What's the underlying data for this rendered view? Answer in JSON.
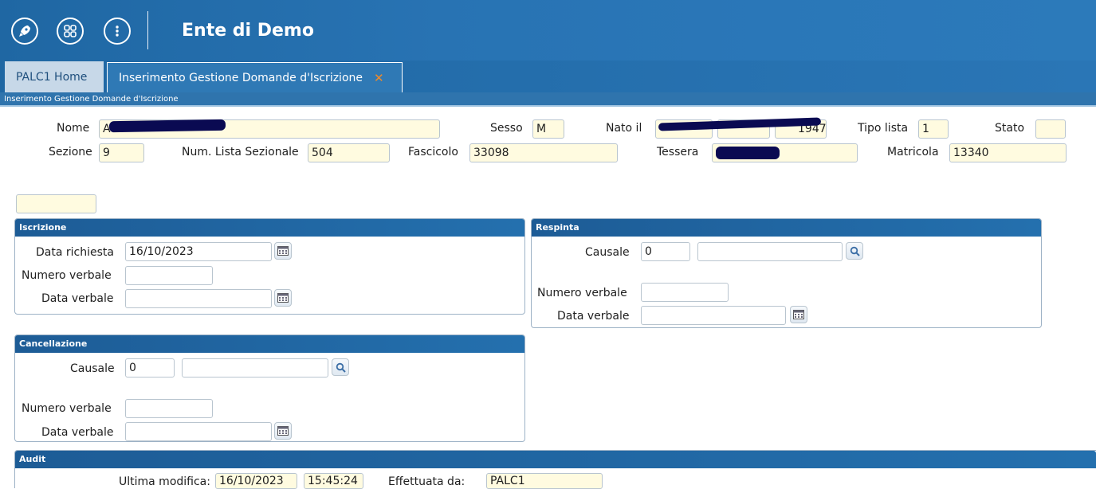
{
  "header": {
    "title": "Ente di Demo",
    "icons": [
      "rocket-icon",
      "apps-grid-icon",
      "more-vertical-icon"
    ]
  },
  "tabs": [
    {
      "label": "PALC1 Home",
      "active": false
    },
    {
      "label": "Inserimento Gestione Domande d'Iscrizione",
      "active": true,
      "close": "✕"
    }
  ],
  "breadcrumb": "Inserimento Gestione Domande d'Iscrizione",
  "anagrafica": {
    "nome_label": "Nome",
    "nome_value": "A",
    "sesso_label": "Sesso",
    "sesso_value": "M",
    "nato_label": "Nato il",
    "nato_year_value": "1947",
    "tipo_lista_label": "Tipo lista",
    "tipo_lista_value": "1",
    "stato_label": "Stato",
    "stato_value": "",
    "sezione_label": "Sezione",
    "sezione_value": "9",
    "num_lista_label": "Num. Lista Sezionale",
    "num_lista_value": "504",
    "fascicolo_label": "Fascicolo",
    "fascicolo_value": "33098",
    "tessera_label": "Tessera",
    "tessera_value": "",
    "matricola_label": "Matricola",
    "matricola_value": "13340"
  },
  "iscrizione": {
    "title": "Iscrizione",
    "data_richiesta_label": "Data richiesta",
    "data_richiesta_value": "16/10/2023",
    "numero_verbale_label": "Numero verbale",
    "numero_verbale_value": "",
    "data_verbale_label": "Data verbale",
    "data_verbale_value": ""
  },
  "respinta": {
    "title": "Respinta",
    "causale_label": "Causale",
    "causale_code": "0",
    "causale_desc": "",
    "numero_verbale_label": "Numero verbale",
    "numero_verbale_value": "",
    "data_verbale_label": "Data verbale",
    "data_verbale_value": ""
  },
  "cancellazione": {
    "title": "Cancellazione",
    "causale_label": "Causale",
    "causale_code": "0",
    "causale_desc": "",
    "numero_verbale_label": "Numero verbale",
    "numero_verbale_value": "",
    "data_verbale_label": "Data verbale",
    "data_verbale_value": ""
  },
  "audit": {
    "title": "Audit",
    "ultima_modifica_label": "Ultima modifica:",
    "data_value": "16/10/2023",
    "ora_value": "15:45:24",
    "effettuata_label": "Effettuata da:",
    "effettuata_value": "PALC1"
  },
  "colors": {
    "header_blue": "#2873b3",
    "panel_head": "#1d5c96",
    "field_bg": "#fffbe0",
    "close_orange": "#f08a2a"
  }
}
